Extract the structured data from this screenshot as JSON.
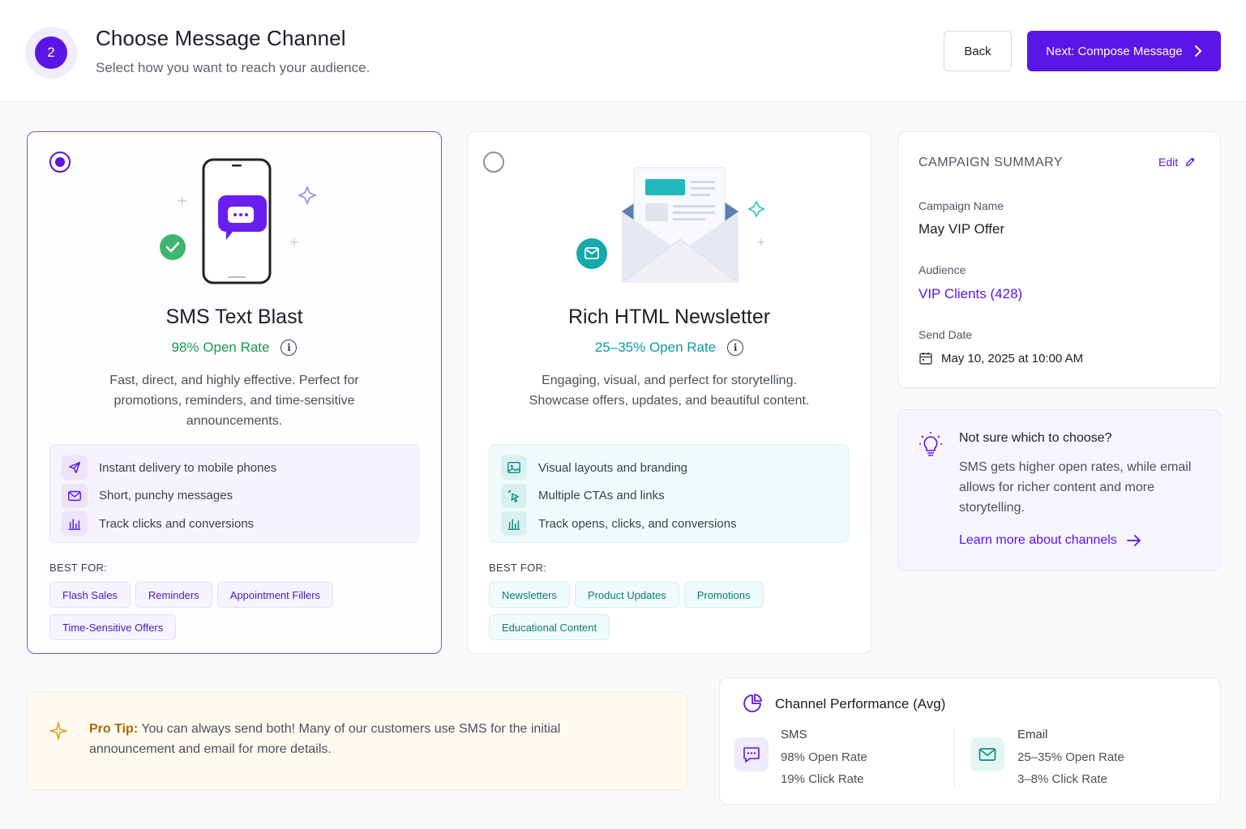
{
  "header": {
    "step_number": "2",
    "title": "Choose Message Channel",
    "subtitle": "Select how you want to reach your audience.",
    "back_label": "Back",
    "next_label": "Next: Compose Message",
    "accent_color": "#5a16e6"
  },
  "channels": {
    "sms": {
      "selected": true,
      "title": "SMS Text Blast",
      "rate": "98% Open Rate",
      "description": "Fast, direct, and highly effective. Perfect for promotions, reminders, and time-sensitive announcements.",
      "features": [
        {
          "icon": "send-icon",
          "label": "Instant delivery to mobile phones"
        },
        {
          "icon": "mail-icon",
          "label": "Short, punchy messages"
        },
        {
          "icon": "bar-chart-icon",
          "label": "Track clicks and conversions"
        }
      ],
      "best_for_label": "BEST FOR:",
      "tags": [
        "Flash Sales",
        "Reminders",
        "Appointment Fillers",
        "Time-Sensitive Offers"
      ]
    },
    "email": {
      "selected": false,
      "title": "Rich HTML Newsletter",
      "rate": "25–35% Open Rate",
      "description": "Engaging, visual, and perfect for storytelling. Showcase offers, updates, and beautiful content.",
      "features": [
        {
          "icon": "image-icon",
          "label": "Visual layouts and branding"
        },
        {
          "icon": "cursor-click-icon",
          "label": "Multiple CTAs and links"
        },
        {
          "icon": "bar-chart-icon",
          "label": "Track opens, clicks, and conversions"
        }
      ],
      "best_for_label": "BEST FOR:",
      "tags": [
        "Newsletters",
        "Product Updates",
        "Promotions",
        "Educational Content"
      ]
    }
  },
  "summary": {
    "heading": "CAMPAIGN SUMMARY",
    "edit_label": "Edit",
    "campaign_name_label": "Campaign Name",
    "campaign_name": "May VIP Offer",
    "audience_label": "Audience",
    "audience": "VIP Clients (428)",
    "send_date_label": "Send Date",
    "send_date": "May 10, 2025 at 10:00 AM"
  },
  "help": {
    "title": "Not sure which to choose?",
    "text": "SMS gets higher open rates, while email allows for richer content and more storytelling.",
    "link": "Learn more about channels"
  },
  "tip": {
    "label": "Pro Tip:",
    "text": "You can always send both! Many of our customers use SMS for the initial announcement and email for more details."
  },
  "performance": {
    "title": "Channel Performance (Avg)",
    "sms": {
      "name": "SMS",
      "open": "98% Open Rate",
      "click": "19% Click Rate"
    },
    "email": {
      "name": "Email",
      "open": "25–35% Open Rate",
      "click": "3–8% Click Rate"
    }
  }
}
